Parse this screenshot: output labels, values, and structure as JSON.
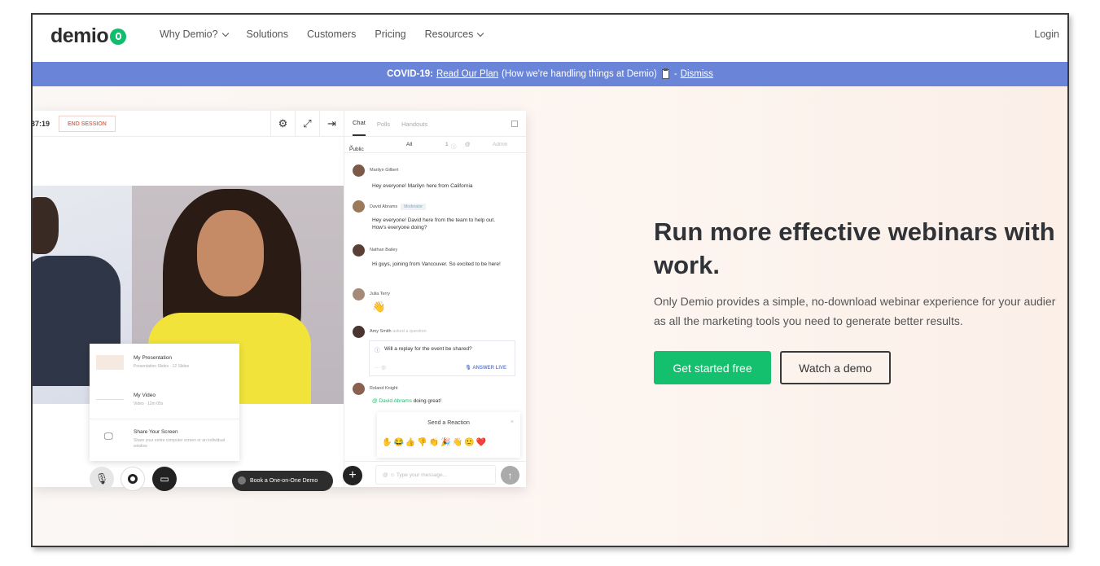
{
  "nav": {
    "logo": "demio",
    "items": [
      {
        "label": "Why Demio?",
        "dropdown": true
      },
      {
        "label": "Solutions",
        "dropdown": false
      },
      {
        "label": "Customers",
        "dropdown": false
      },
      {
        "label": "Pricing",
        "dropdown": false
      },
      {
        "label": "Resources",
        "dropdown": true
      }
    ],
    "login": "Login"
  },
  "banner": {
    "prefix": "COVID-19:",
    "link": "Read Our Plan",
    "middle": "(How we're handling things at Demio)",
    "dash": "-",
    "dismiss": "Dismiss",
    "color": "#6a85d8"
  },
  "app": {
    "timer": "37:19",
    "end_session": "END SESSION",
    "chat_tabs": [
      "Chat",
      "Polls",
      "Handouts"
    ],
    "filter": {
      "scope": "Public",
      "all": "All",
      "count": "1",
      "admin": "Admin"
    },
    "messages": [
      {
        "name": "Marilyn Gilbert",
        "text": "Hey everyone! Marilyn here from California"
      },
      {
        "name": "David Abrams",
        "tag": "Moderator",
        "text": "Hey everyone! David here from the team to help out. How's everyone doing?"
      },
      {
        "name": "Nathan Bailey",
        "text": "Hi guys, joining from Vancouver. So excited to be here!"
      },
      {
        "name": "Julia Terry",
        "text": "👋"
      },
      {
        "name": "Amy Smith",
        "note": "asked a question",
        "question": "Will a replay for the event be shared?",
        "answer_label": "ANSWER LIVE"
      },
      {
        "name": "Roland Knight",
        "mention": "@ David Abrams",
        "text": "doing great!"
      }
    ],
    "reaction": {
      "title": "Send a Reaction",
      "emojis": [
        "✋",
        "😂",
        "👍",
        "👎",
        "👏",
        "🎉",
        "👋",
        "🙂",
        "❤️"
      ]
    },
    "input_placeholder": "Type your message...",
    "popup": [
      {
        "title": "My Presentation",
        "sub": "Presentation Slides · 12 Slides"
      },
      {
        "title": "My Video",
        "sub": "Video · 12m 05s"
      },
      {
        "title": "Share Your Screen",
        "sub": "Share your entire computer screen or an individual window"
      }
    ],
    "book_demo": "Book a One-on-One Demo"
  },
  "hero": {
    "headline_line1": "Run more effective webinars with",
    "headline_line2": "work.",
    "sub_line1": "Only Demio provides a simple, no-download webinar experience for your audier",
    "sub_line2": "as all the marketing tools you need to generate better results.",
    "cta_primary": "Get started free",
    "cta_secondary": "Watch a demo",
    "accent": "#14c06e"
  }
}
